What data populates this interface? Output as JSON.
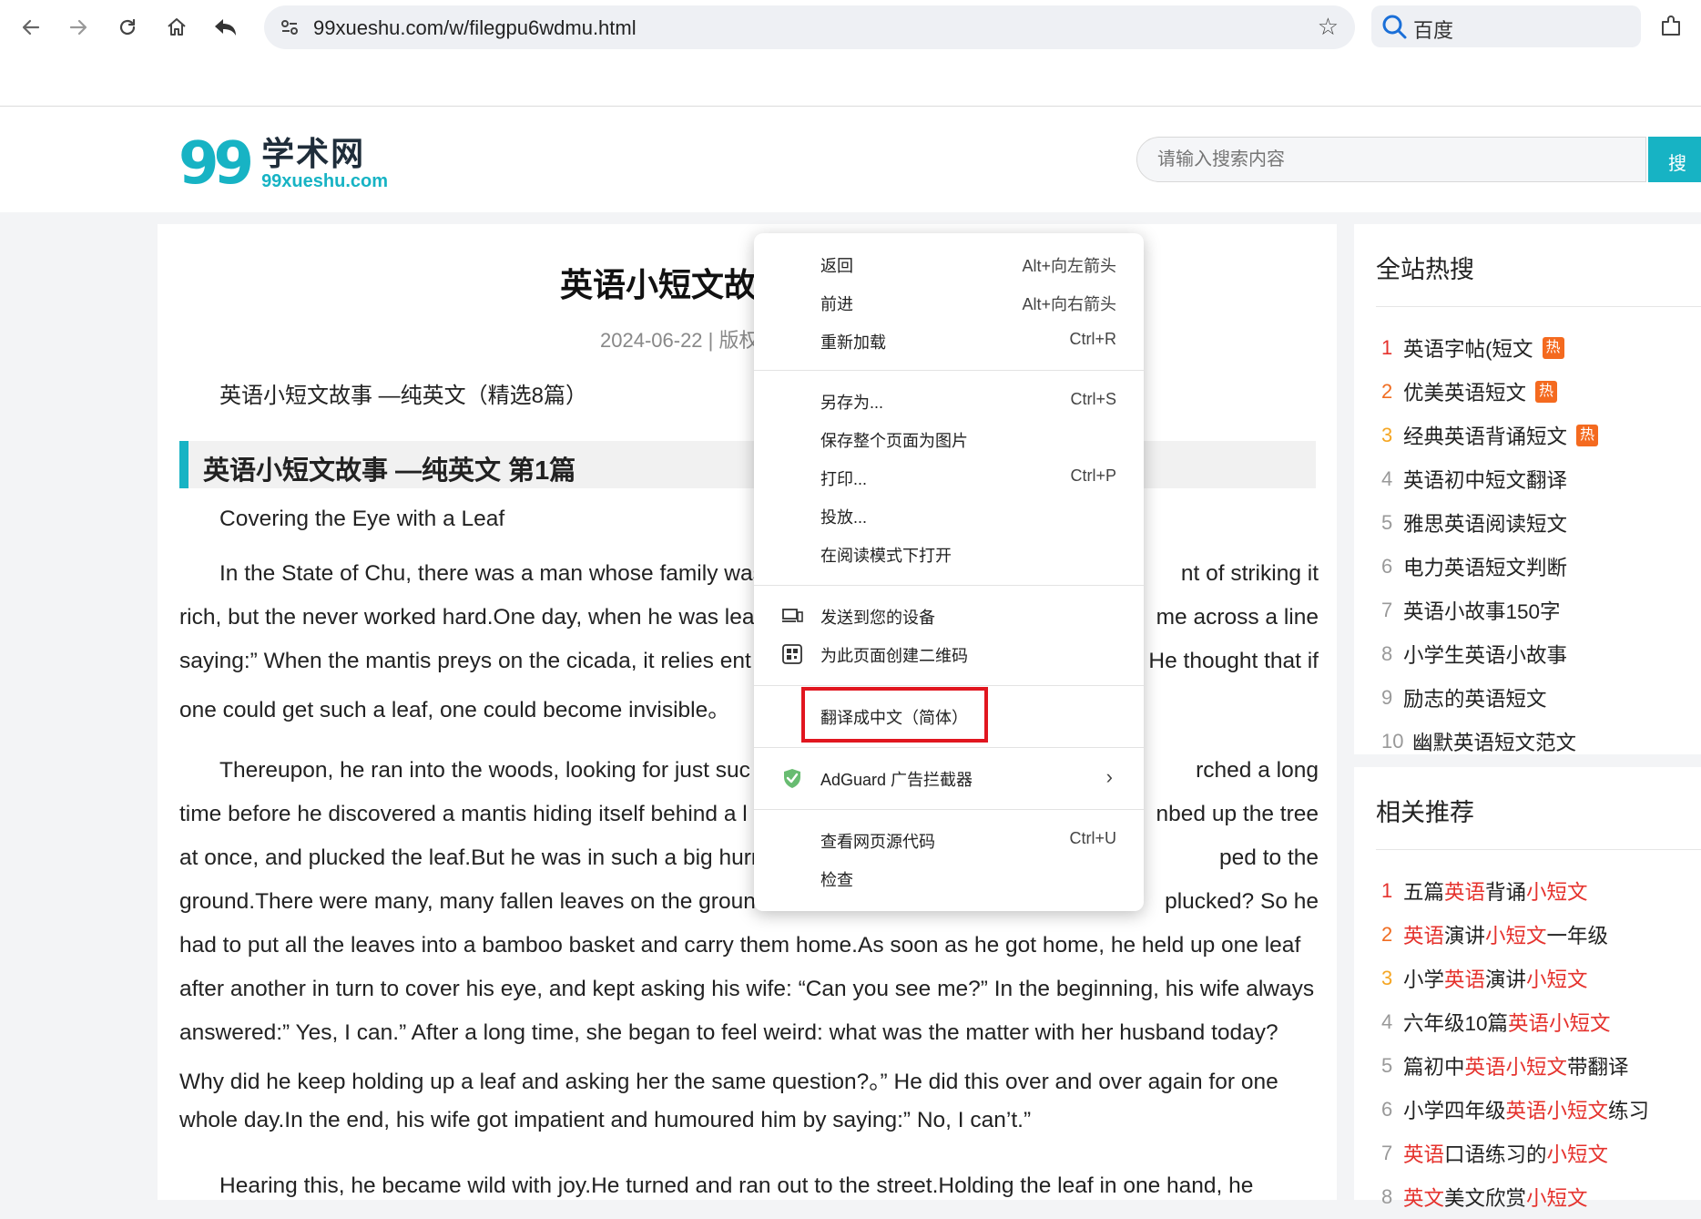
{
  "browser": {
    "url": "99xueshu.com/w/filegpu6wdmu.html",
    "search_label": "百度"
  },
  "site": {
    "logo_cn": "学术网",
    "logo_en": "99xueshu.com",
    "logo_mark": "99",
    "search_placeholder": "请输入搜索内容",
    "search_btn": "搜"
  },
  "article": {
    "title": "英语小短文故",
    "meta": "2024-06-22 | 版权",
    "intro": "英语小短文故事 —纯英文（精选8篇）",
    "section_heading": "英语小短文故事 —纯英文 第1篇",
    "story_title": "Covering the Eye with a Leaf",
    "paragraphs": [
      "In the State of Chu, there was a man whose family was  nt of striking it rich, but the never worked hard.One day, when he was leaf  me across a line saying:”  When the mantis preys on the cicada, it relies ent  He thought that if one could get such a leaf, one could become invisible。",
      "Thereupon, he ran into the woods, looking for just suc  rched a long time before he discovered a mantis hiding itself behind a l  nbed up the tree at once, and plucked the leaf.But he was in such a big hurr  ped to the ground.There were many, many fallen leaves on the ground  plucked?  So he had to put all the leaves into a bamboo basket and carry them home.As soon as he got home, he held up one leaf after another in turn to cover his eye, and kept asking his wife: “Can you see me?” In the beginning, his wife always answered:”  Yes, I can.” After a long time, she began to feel weird: what was the matter with her husband today? Why did he keep holding up a leaf and asking her the same question?。”  He did this over and over again for one whole day.In the end, his wife got impatient and humoured him by saying:”  No, I can’t.”",
      "Hearing this, he became wild with joy.He turned and ran out to the street.Holding the leaf in one hand, he"
    ],
    "lines": [
      {
        "text": "In the State of Chu, there was a man whose family was",
        "right": "nt of striking it"
      },
      {
        "text": "rich, but the never worked hard.One day, when he was leaf",
        "right": "me across a line"
      },
      {
        "text": "saying:”   When the mantis preys on the cicada, it relies ent",
        "right": "He thought that if"
      },
      {
        "text": "one could get such a leaf, one could become invisible。",
        "right": ""
      },
      {
        "text": "Thereupon, he ran into the woods, looking for just suc",
        "right": "rched a long"
      },
      {
        "text": "time before he discovered a mantis hiding itself behind a l",
        "right": "nbed up the tree"
      },
      {
        "text": "at once, and plucked the leaf.But he was in such a big hurr",
        "right": "ped to the"
      },
      {
        "text": "ground.There were many, many fallen leaves on the ground",
        "right": "plucked?   So he"
      },
      {
        "text": "had to put all the leaves into a bamboo basket and carry them home.As soon as he got home, he held up one leaf",
        "right": ""
      },
      {
        "text": "after another in turn to cover his eye, and kept asking his wife: “Can you see me?” In the beginning, his wife always",
        "right": ""
      },
      {
        "text": "answered:”   Yes, I can.” After a long time, she began to feel weird: what was the matter with her husband today?",
        "right": ""
      },
      {
        "text": "Why did he keep holding up a leaf and asking her the same question?。”   He did this over and over again for one",
        "right": ""
      },
      {
        "text": "whole day.In the end, his wife got impatient and humoured him by saying:”   No, I can’t.”",
        "right": ""
      },
      {
        "text": "Hearing this, he became wild with joy.He turned and ran out to the street.Holding the leaf in one hand, he",
        "right": ""
      }
    ]
  },
  "hot_search": {
    "title": "全站热搜",
    "hot_badge": "热",
    "items": [
      {
        "num": "1",
        "text": "英语字帖(短文",
        "hot": true
      },
      {
        "num": "2",
        "text": "优美英语短文",
        "hot": true
      },
      {
        "num": "3",
        "text": "经典英语背诵短文",
        "hot": true
      },
      {
        "num": "4",
        "text": "英语初中短文翻译",
        "hot": false
      },
      {
        "num": "5",
        "text": "雅思英语阅读短文",
        "hot": false
      },
      {
        "num": "6",
        "text": "电力英语短文判断",
        "hot": false
      },
      {
        "num": "7",
        "text": "英语小故事150字",
        "hot": false
      },
      {
        "num": "8",
        "text": "小学生英语小故事",
        "hot": false
      },
      {
        "num": "9",
        "text": "励志的英语短文",
        "hot": false
      },
      {
        "num": "10",
        "text": "幽默英语短文范文",
        "hot": false
      }
    ]
  },
  "related": {
    "title": "相关推荐",
    "items": [
      {
        "num": "1",
        "parts": [
          [
            "五篇",
            false
          ],
          [
            "英语",
            true
          ],
          [
            "背诵",
            false
          ],
          [
            "小短文",
            true
          ]
        ]
      },
      {
        "num": "2",
        "parts": [
          [
            "英语",
            true
          ],
          [
            "演讲",
            false
          ],
          [
            "小短文",
            true
          ],
          [
            "一年级",
            false
          ]
        ]
      },
      {
        "num": "3",
        "parts": [
          [
            "小学",
            false
          ],
          [
            "英语",
            true
          ],
          [
            "演讲",
            false
          ],
          [
            "小短文",
            true
          ]
        ]
      },
      {
        "num": "4",
        "parts": [
          [
            "六年级10篇",
            false
          ],
          [
            "英语小短文",
            true
          ]
        ]
      },
      {
        "num": "5",
        "parts": [
          [
            "篇初中",
            false
          ],
          [
            "英语小短文",
            true
          ],
          [
            "带翻译",
            false
          ]
        ]
      },
      {
        "num": "6",
        "parts": [
          [
            "小学四年级",
            false
          ],
          [
            "英语小短文",
            true
          ],
          [
            "练习",
            false
          ]
        ]
      },
      {
        "num": "7",
        "parts": [
          [
            "英语",
            true
          ],
          [
            "口语练习的",
            false
          ],
          [
            "小短文",
            true
          ]
        ]
      },
      {
        "num": "8",
        "parts": [
          [
            "英文",
            true
          ],
          [
            "美文欣赏",
            false
          ],
          [
            "小短文",
            true
          ]
        ]
      }
    ]
  },
  "context_menu": {
    "back": {
      "label": "返回",
      "shortcut": "Alt+向左箭头"
    },
    "forward": {
      "label": "前进",
      "shortcut": "Alt+向右箭头"
    },
    "reload": {
      "label": "重新加载",
      "shortcut": "Ctrl+R"
    },
    "save_as": {
      "label": "另存为...",
      "shortcut": "Ctrl+S"
    },
    "save_image": {
      "label": "保存整个页面为图片"
    },
    "print": {
      "label": "打印...",
      "shortcut": "Ctrl+P"
    },
    "cast": {
      "label": "投放..."
    },
    "reader": {
      "label": "在阅读模式下打开"
    },
    "send_device": {
      "label": "发送到您的设备"
    },
    "qr": {
      "label": "为此页面创建二维码"
    },
    "translate": {
      "label": "翻译成中文（简体）"
    },
    "adguard": {
      "label": "AdGuard 广告拦截器"
    },
    "view_source": {
      "label": "查看网页源代码",
      "shortcut": "Ctrl+U"
    },
    "inspect": {
      "label": "检查"
    }
  },
  "colors": {
    "accent": "#17b3c4",
    "hot": "#f46a1f",
    "highlight_red": "#e1161f",
    "link_red": "#e5322d"
  }
}
